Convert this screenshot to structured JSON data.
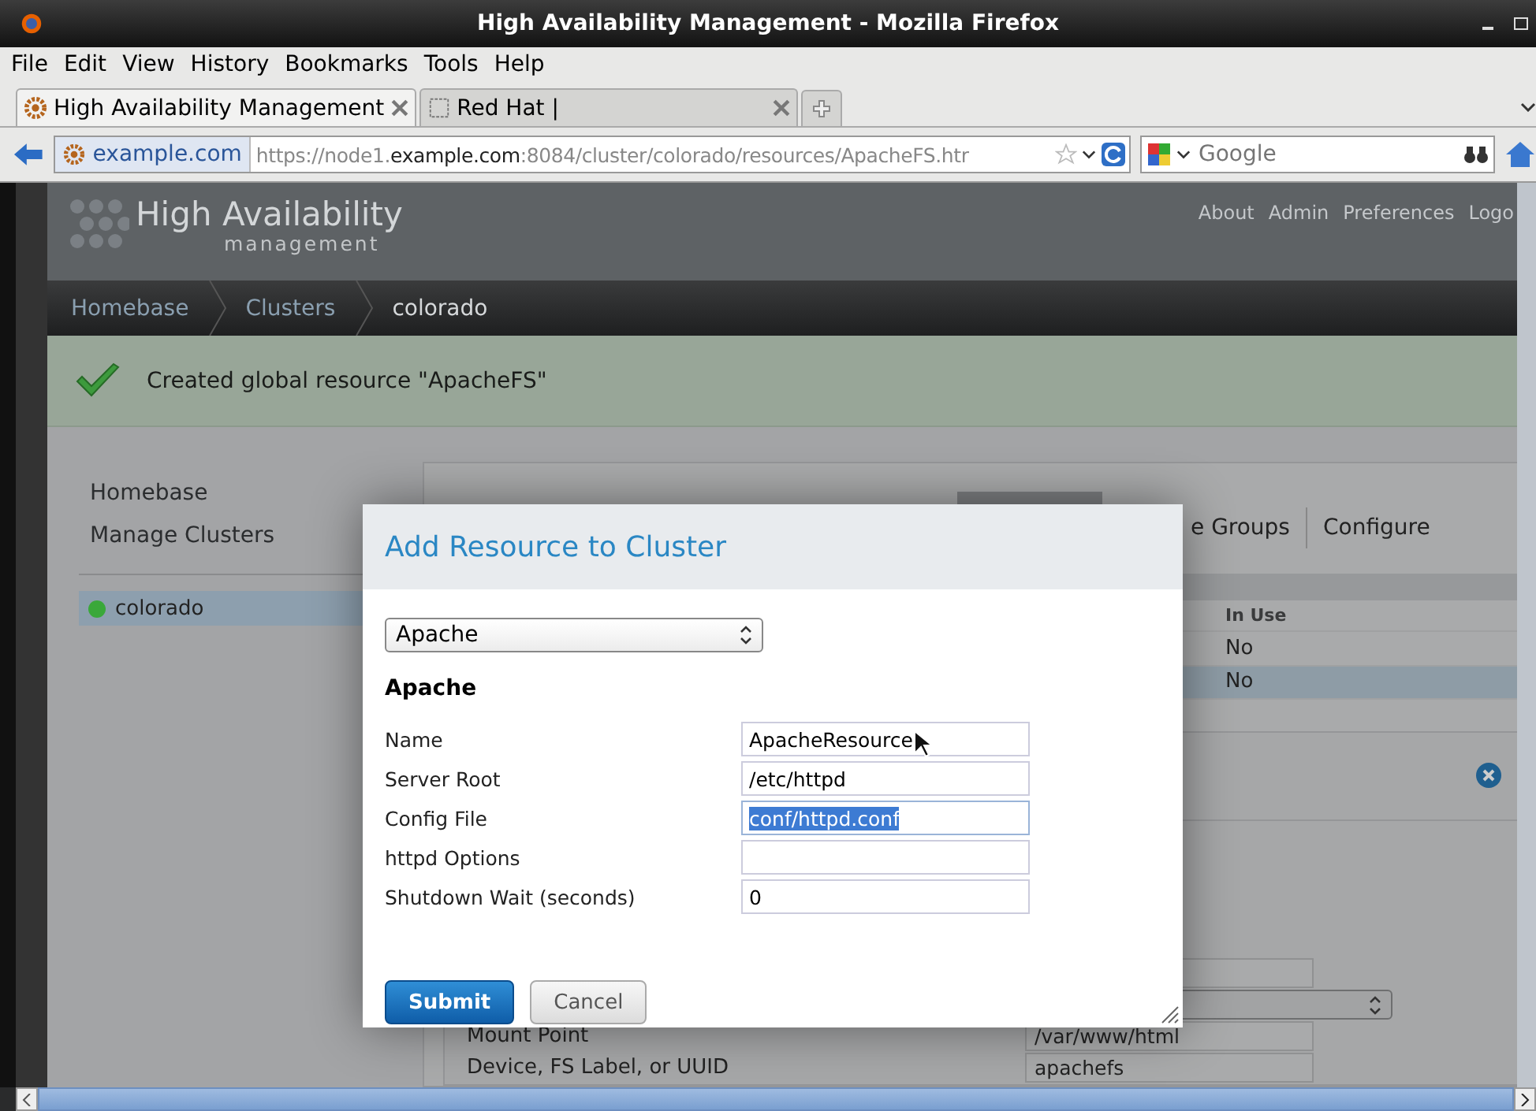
{
  "window": {
    "title": "High Availability Management - Mozilla Firefox"
  },
  "menu": [
    "File",
    "Edit",
    "View",
    "History",
    "Bookmarks",
    "Tools",
    "Help"
  ],
  "tabs": [
    {
      "label": "High Availability Management",
      "selected": true
    },
    {
      "label": "Red Hat |",
      "selected": false
    }
  ],
  "navigation": {
    "site_identity": "example.com",
    "url": "https://node1.**example.com**:8084/cluster/colorado/resources/ApacheFS.htr",
    "search_placeholder": "Google"
  },
  "page": {
    "logo_title": "High Availability",
    "logo_subtitle": "management",
    "top_links": [
      "About",
      "Admin",
      "Preferences",
      "Logo"
    ],
    "breadcrumbs": [
      {
        "label": "Homebase",
        "current": false
      },
      {
        "label": "Clusters",
        "current": false
      },
      {
        "label": "colorado",
        "current": true
      }
    ],
    "notice": "Created global resource \"ApacheFS\"",
    "sidebar": {
      "items": [
        "Homebase",
        "Manage Clusters"
      ],
      "clusters": [
        {
          "name": "colorado",
          "selected": true,
          "color": "#3aa83a"
        }
      ]
    },
    "section_tabs": [
      {
        "label": "e Groups"
      },
      {
        "label": "Configure"
      }
    ],
    "table": {
      "columns": [
        "In Use"
      ],
      "rows": [
        {
          "cells": [
            "No"
          ],
          "selected": false
        },
        {
          "cells": [
            "No"
          ],
          "selected": true
        }
      ]
    },
    "details": [
      {
        "label": "Mount Point",
        "value": "/var/www/html"
      },
      {
        "label": "Device, FS Label, or UUID",
        "value": "apachefs"
      }
    ]
  },
  "dialog": {
    "title": "Add Resource to Cluster",
    "resource_type": "Apache",
    "section": "Apache",
    "fields": [
      {
        "label": "Name",
        "value": "ApacheResource",
        "highlighted": false
      },
      {
        "label": "Server Root",
        "value": "/etc/httpd",
        "highlighted": false
      },
      {
        "label": "Config File",
        "value": "conf/httpd.conf",
        "highlighted": true
      },
      {
        "label": "httpd Options",
        "highlighted": false
      },
      {
        "label": "Shutdown Wait (seconds)",
        "value": "0",
        "highlighted": false
      }
    ],
    "buttons": [
      {
        "label": "Submit",
        "kind": "primary"
      },
      {
        "label": "Cancel",
        "kind": "secondary"
      }
    ]
  }
}
